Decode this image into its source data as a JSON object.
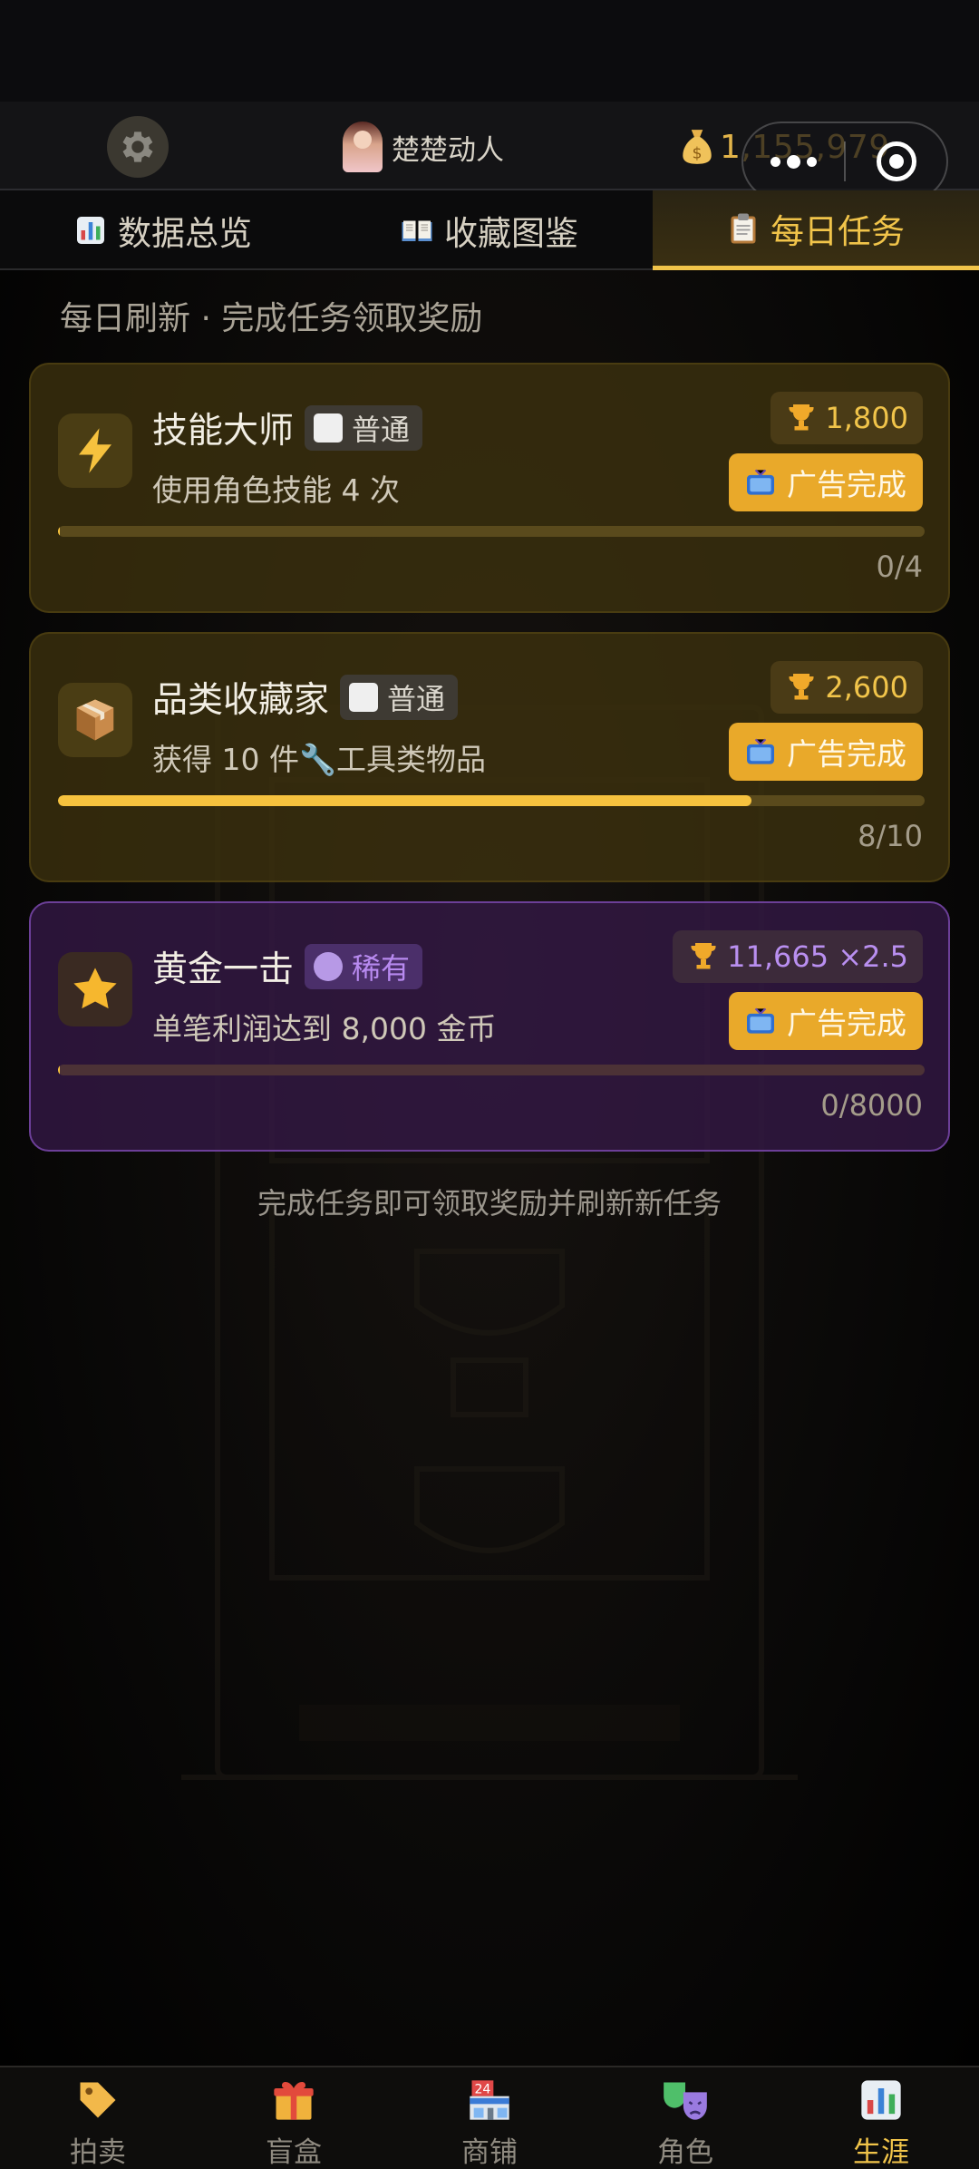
{
  "header": {
    "username": "楚楚动人",
    "coins": "1,155,979",
    "icons": {
      "settings": "gear-icon",
      "avatar": "avatar-image",
      "coins": "money-bag-icon",
      "more": "more-dots-icon",
      "close": "target-icon"
    }
  },
  "tabs": [
    {
      "label": "数据总览",
      "icon": "bar-chart-icon",
      "active": false
    },
    {
      "label": "收藏图鉴",
      "icon": "open-book-icon",
      "active": false
    },
    {
      "label": "每日任务",
      "icon": "clipboard-icon",
      "active": true
    }
  ],
  "subtitle": "每日刷新 · 完成任务领取奖励",
  "tasks": [
    {
      "title": "技能大师",
      "rarity": "普通",
      "description": "使用角色技能 4 次",
      "reward": "1,800",
      "action": "广告完成",
      "progress_text": "0/4",
      "progress": 0,
      "icon": "lightning-icon"
    },
    {
      "title": "品类收藏家",
      "rarity": "普通",
      "description": "获得 10 件🔧工具类物品",
      "reward": "2,600",
      "action": "广告完成",
      "progress_text": "8/10",
      "progress": 0.8,
      "icon": "package-icon"
    },
    {
      "title": "黄金一击",
      "rarity": "稀有",
      "description": "单笔利润达到 8,000 金币",
      "reward": "11,665 ×2.5",
      "action": "广告完成",
      "progress_text": "0/8000",
      "progress": 0,
      "icon": "star-icon"
    }
  ],
  "footer_note": "完成任务即可领取奖励并刷新新任务",
  "bottom_nav": [
    {
      "label": "拍卖",
      "icon": "price-tag-icon",
      "active": false
    },
    {
      "label": "盲盒",
      "icon": "gift-box-icon",
      "active": false
    },
    {
      "label": "商铺",
      "icon": "convenience-store-icon",
      "active": false
    },
    {
      "label": "角色",
      "icon": "theater-masks-icon",
      "active": false
    },
    {
      "label": "生涯",
      "icon": "bar-chart-icon",
      "active": true
    }
  ],
  "colors": {
    "accent": "#f1c44a",
    "rare": "#b98ff0",
    "ad_button": "#e9a92a"
  }
}
